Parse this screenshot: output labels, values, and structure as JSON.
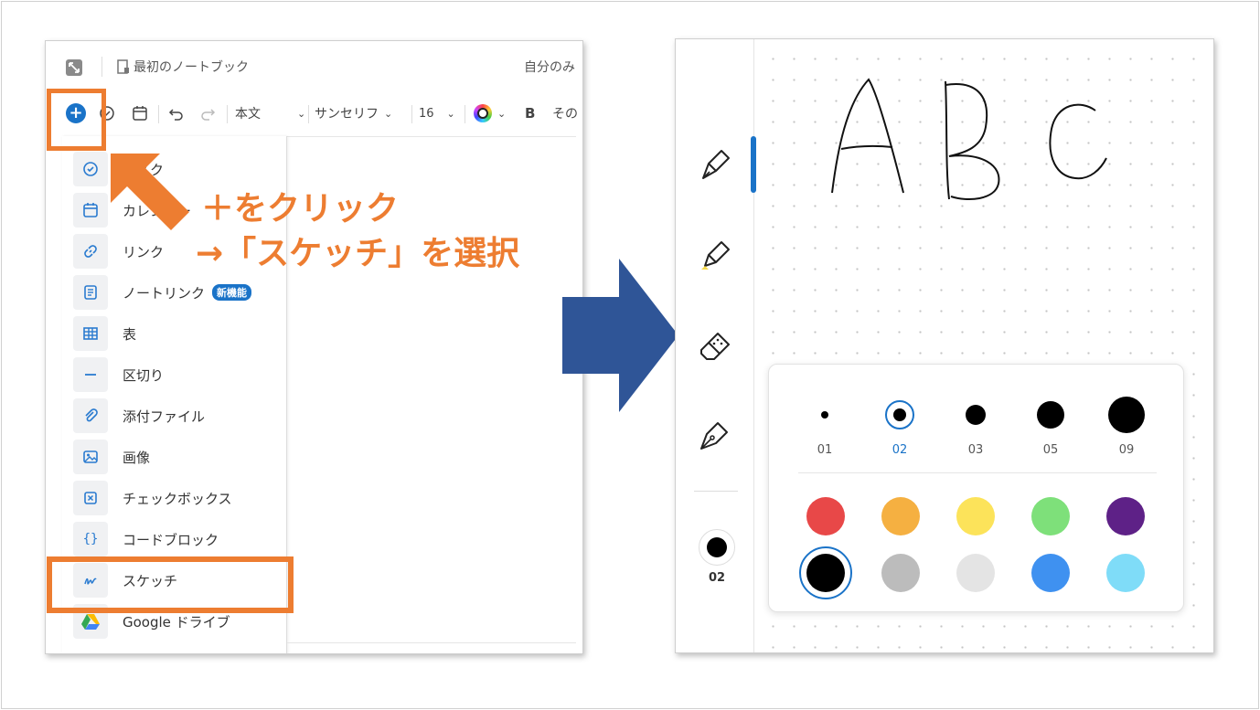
{
  "left_window": {
    "notebook_title": "最初のノートブック",
    "owner_label": "自分のみ",
    "toolbar": {
      "plus_glyph": "+",
      "style_select": "本文",
      "font_select": "サンセリフ",
      "size_select": "16",
      "bold_label": "B",
      "more_label": "その"
    },
    "menu_items": [
      {
        "label": "タスク",
        "icon": "check-circle-icon"
      },
      {
        "label": "カレンダー",
        "icon": "calendar-icon"
      },
      {
        "label": "リンク",
        "icon": "link-icon"
      },
      {
        "label": "ノートリンク",
        "icon": "note-icon",
        "badge": "新機能"
      },
      {
        "label": "表",
        "icon": "table-icon"
      },
      {
        "label": "区切り",
        "icon": "divider-icon"
      },
      {
        "label": "添付ファイル",
        "icon": "paperclip-icon"
      },
      {
        "label": "画像",
        "icon": "image-icon"
      },
      {
        "label": "チェックボックス",
        "icon": "checkbox-icon"
      },
      {
        "label": "コードブロック",
        "icon": "code-icon"
      },
      {
        "label": "スケッチ",
        "icon": "sketch-icon"
      },
      {
        "label": "Google ドライブ",
        "icon": "google-drive-icon"
      }
    ]
  },
  "annotation": {
    "line1": "＋をクリック",
    "line2": "→「スケッチ」を選択",
    "color": "#ed7d31"
  },
  "arrow_color": "#2f5597",
  "right_window": {
    "tools": [
      "pen-icon",
      "highlighter-icon",
      "eraser-icon",
      "fountain-pen-icon"
    ],
    "current_size_label": "02",
    "sizes": [
      {
        "label": "01",
        "selected": false
      },
      {
        "label": "02",
        "selected": true
      },
      {
        "label": "03",
        "selected": false
      },
      {
        "label": "05",
        "selected": false
      },
      {
        "label": "09",
        "selected": false
      }
    ],
    "colors": [
      "#e84848",
      "#f5b041",
      "#fce35a",
      "#7ee07a",
      "#5e2187",
      "#000000",
      "#bcbcbc",
      "#e4e4e4",
      "#3f91f0",
      "#7fdcf8"
    ],
    "selected_color": "#000000",
    "accent": "#1a73c8"
  }
}
